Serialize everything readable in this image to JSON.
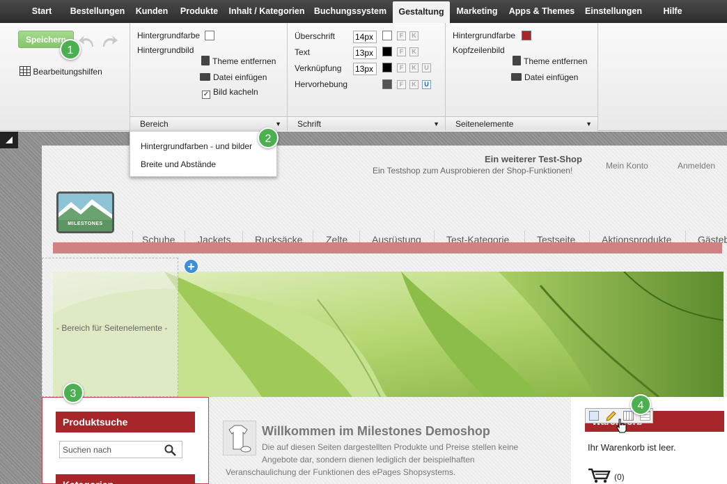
{
  "nav": {
    "items": [
      "Start",
      "Bestellungen",
      "Kunden",
      "Produkte",
      "Inhalt / Kategorien",
      "Buchungssystem",
      "Gestaltung",
      "Marketing",
      "Apps & Themes",
      "Einstellungen",
      "Hilfe"
    ],
    "active": "Gestaltung"
  },
  "toolbar": {
    "save_label": "Speichern",
    "editing_aids_label": "Bearbeitungshilfen"
  },
  "panel_area": {
    "bg_color_label": "Hintergrundfarbe",
    "bg_image_label": "Hintergrundbild",
    "remove_theme": "Theme entfernen",
    "insert_file": "Datei einfügen",
    "tile_image": "Bild kacheln",
    "tile_checked": true,
    "footer": "Bereich",
    "dropdown": [
      "Hintergrundfarben - und bilder",
      "Breite und Abstände"
    ]
  },
  "panel_font": {
    "rows": [
      {
        "label": "Überschrift",
        "size": "14px",
        "color": "#ffffff"
      },
      {
        "label": "Text",
        "size": "13px",
        "color": "#000000"
      },
      {
        "label": "Verknüpfung",
        "size": "13px",
        "color": "#000000"
      },
      {
        "label": "Hervorhebung",
        "size": "",
        "color": "#555555"
      }
    ],
    "bold_letter": "F",
    "italic_letter": "K",
    "underline_letter": "U",
    "footer": "Schrift"
  },
  "panel_elements": {
    "bg_color_label": "Hintergrundfarbe",
    "bg_color": "#a6262a",
    "header_image_label": "Kopfzeilenbild",
    "remove_theme": "Theme entfernen",
    "insert_file": "Datei einfügen",
    "footer": "Seitenelemente"
  },
  "badges": [
    "1",
    "2",
    "3",
    "4"
  ],
  "shop": {
    "name": "Ein weiterer Test-Shop",
    "tagline": "Ein Testshop zum Ausprobieren der Shop-Funktionen!",
    "my_account": "Mein Konto",
    "login": "Anmelden",
    "logo_text": "MILESTONES",
    "nav": [
      "Schuhe",
      "Jackets",
      "Rucksäcke",
      "Zelte",
      "Ausrüstung",
      "Test-Kategorie",
      "Testseite",
      "Aktionsprodukte",
      "Gästeb"
    ],
    "page_elements_area": "- Bereich für Seitenelemente -",
    "search_title": "Produktsuche",
    "search_placeholder": "Suchen nach",
    "category_title": "Kategorien",
    "welcome_title": "Willkommen im Milestones Demoshop",
    "welcome_text": "Die auf diesen Seiten dargestellten Produkte und Preise stellen keine Angebote dar, sondern dienen lediglich der beispielhaften",
    "welcome_text2": "Veranschaulichung der Funktionen des ePages Shopsystems.",
    "cart_title": "Warenkorb",
    "cart_empty": "Ihr Warenkorb ist leer.",
    "cart_count": "(0)",
    "accent": "#a6262a"
  }
}
